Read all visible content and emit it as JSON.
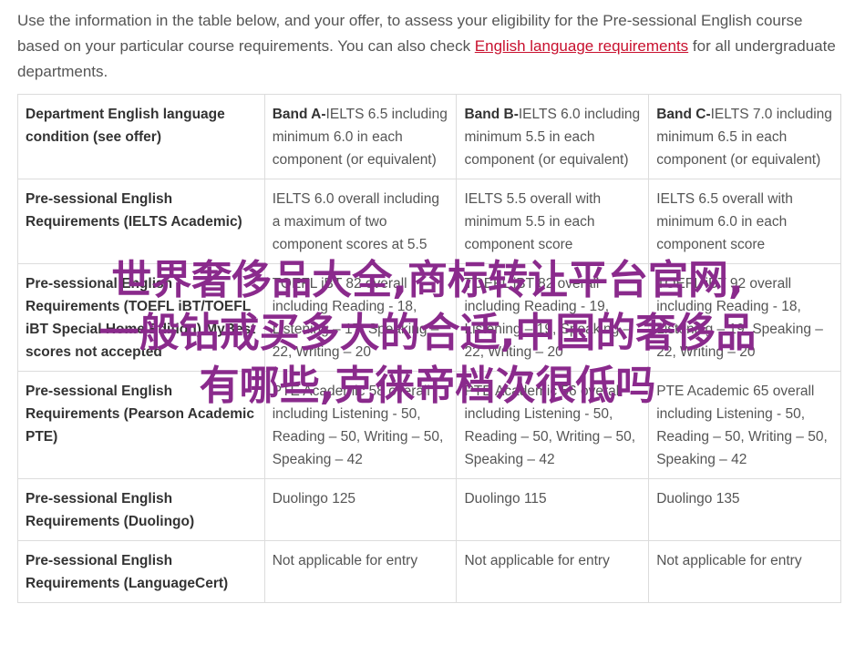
{
  "intro": {
    "text_before": "Use the information in the table below, and your offer, to assess your eligibility for the Pre-sessional English course based on your particular course requirements. You can also check ",
    "link": "English language requirements",
    "text_after": " for all undergraduate departments."
  },
  "table": {
    "header": {
      "col0": "Department English language condition (see offer)",
      "bands": [
        {
          "name": "Band A-",
          "text": "IELTS 6.5 including minimum 6.0 in each component (or equivalent)"
        },
        {
          "name": "Band B-",
          "text": "IELTS 6.0 including minimum 5.5 in each component (or equivalent)"
        },
        {
          "name": "Band C-",
          "text": "IELTS 7.0 including minimum 6.5 in each component (or equivalent)"
        }
      ]
    },
    "rows": [
      {
        "label": "Pre-sessional English Requirements (IELTS Academic)",
        "cells": [
          "IELTS 6.0 overall including a maximum of two component scores at 5.5",
          "IELTS 5.5 overall with minimum 5.5 in each component score",
          "IELTS 6.5 overall with minimum 6.0 in each component score"
        ]
      },
      {
        "label": "Pre-sessional English Requirements (TOEFL iBT/TOEFL iBT Special Home Edition) MyBest scores not accepted",
        "cells": [
          "TOEFL iBT 82 overall including Reading - 18, Listening – 17, Speaking – 22, Writing – 20",
          "TOEFL iBT 82 overall including Reading - 19, Listening – 19, Speaking – 22, Writing – 20",
          "TOEFL iBT 92 overall including Reading - 18, Listening – 19, Speaking – 22, Writing – 20"
        ]
      },
      {
        "label": "Pre-sessional English Requirements (Pearson Academic PTE)",
        "cells": [
          "PTE Academic 58 overall including Listening - 50, Reading – 50, Writing – 50, Speaking – 42",
          "PTE Academic 56 overall including Listening - 50, Reading – 50, Writing – 50, Speaking – 42",
          "PTE Academic 65 overall including Listening - 50, Reading – 50, Writing – 50, Speaking – 42"
        ]
      },
      {
        "label": "Pre-sessional English Requirements (Duolingo)",
        "cells": [
          "Duolingo 125",
          "Duolingo 115",
          "Duolingo 135"
        ]
      },
      {
        "label": "Pre-sessional English Requirements (LanguageCert)",
        "cells": [
          "Not applicable for entry",
          "Not applicable for entry",
          "Not applicable for entry"
        ]
      }
    ]
  },
  "overlay": {
    "line1": "世界奢侈品大全,商标转让平台官网,",
    "line2": "一般钻戒买多大的合适,中国的奢侈品",
    "line3": "有哪些,克徕帝档次很低吗"
  }
}
